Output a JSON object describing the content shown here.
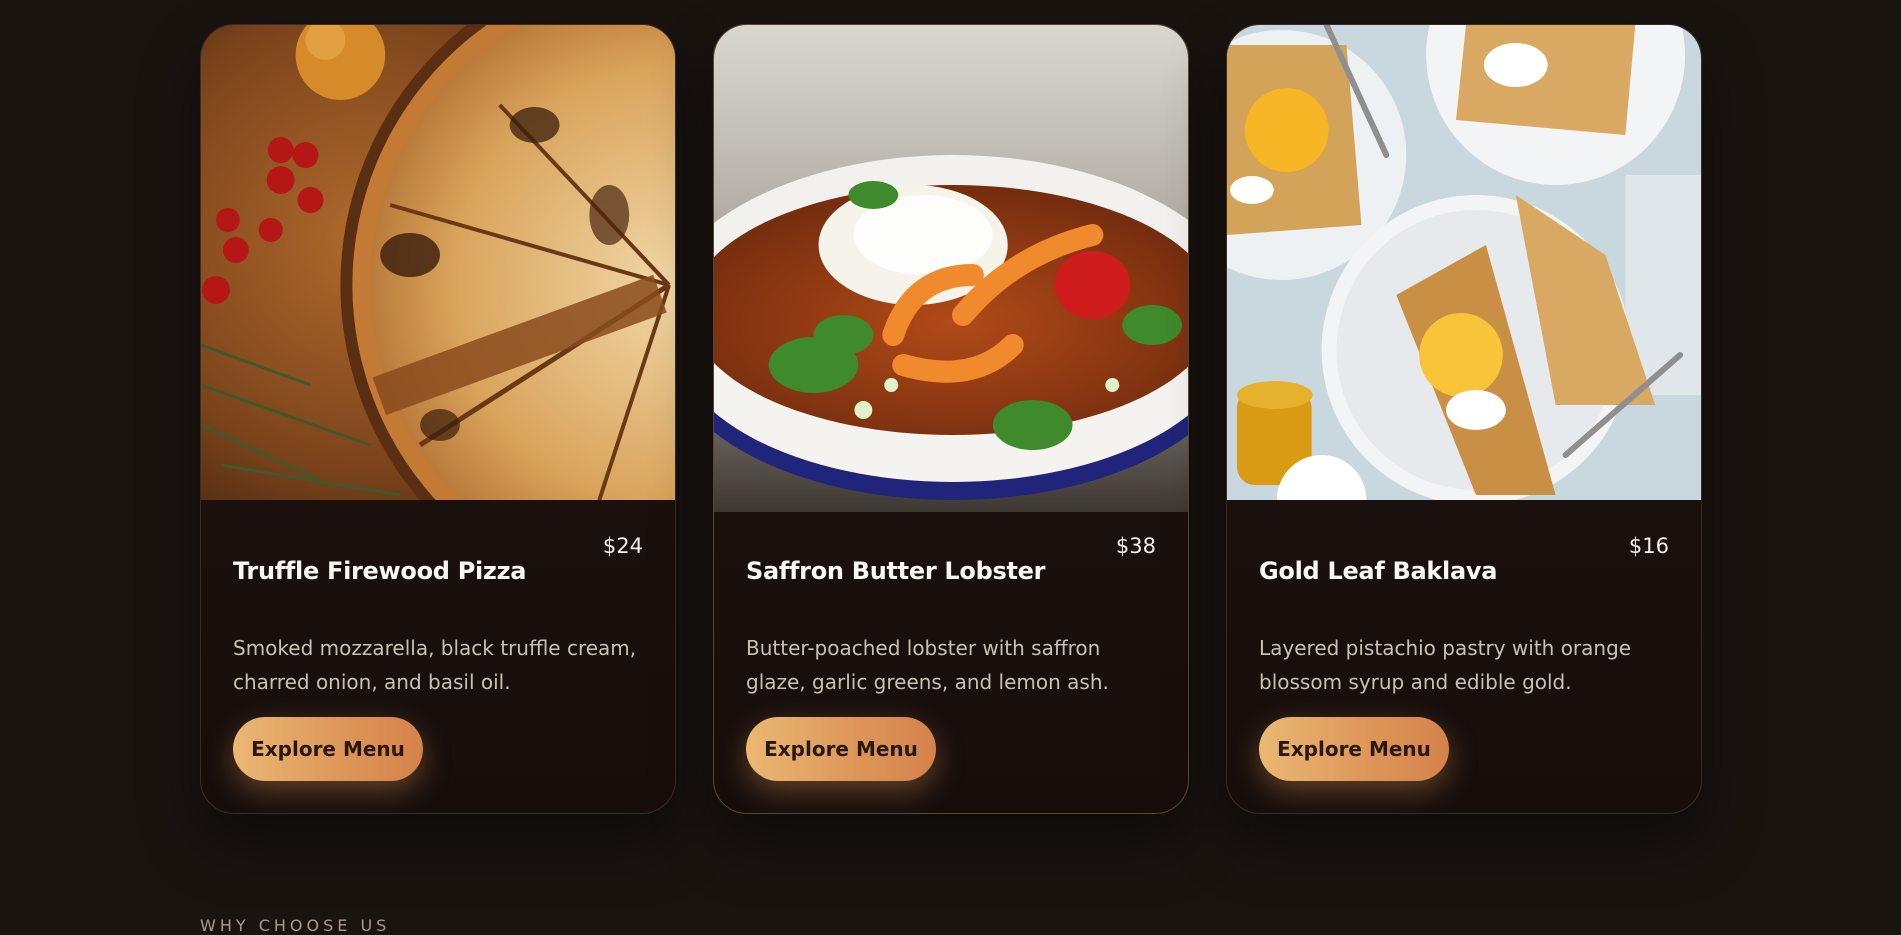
{
  "cards": [
    {
      "title": "Truffle Firewood Pizza",
      "price": "$24",
      "description": "Smoked mozzarella, black truffle cream, charred onion, and basil oil.",
      "button_label": "Explore Menu",
      "image": "pizza-photo"
    },
    {
      "title": "Saffron Butter Lobster",
      "price": "$38",
      "description": "Butter-poached lobster with saffron glaze, garlic greens, and lemon ash.",
      "button_label": "Explore Menu",
      "image": "lobster-bowl-photo"
    },
    {
      "title": "Gold Leaf Baklava",
      "price": "$16",
      "description": "Layered pistachio pastry with orange blossom syrup and edible gold.",
      "button_label": "Explore Menu",
      "image": "crepes-photo"
    }
  ],
  "section": {
    "eyebrow": "WHY CHOOSE US"
  },
  "colors": {
    "background": "#1a1411",
    "button_start": "#eab873",
    "button_end": "#d4824b"
  }
}
